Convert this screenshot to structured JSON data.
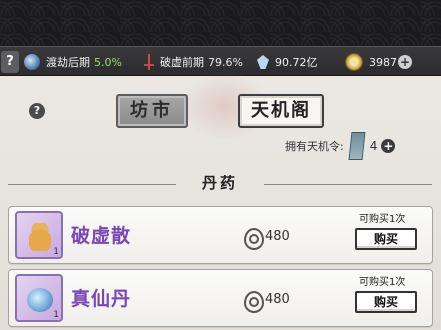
{
  "status_bar": {
    "help": "?",
    "realm": {
      "label": "渡劫后期",
      "percent": "5.0%"
    },
    "breakthrough": {
      "label": "破虚前期",
      "percent": "79.6%"
    },
    "spirit_stones": "90.72亿",
    "currency": "3987",
    "add": "+"
  },
  "tabs": [
    {
      "label": "坊市",
      "selected": true
    },
    {
      "label": "天机阁",
      "selected": false
    }
  ],
  "help_label": "?",
  "tokens": {
    "label": "拥有天机令:",
    "count": "4",
    "add": "+"
  },
  "section_title": "丹药",
  "items": [
    {
      "name": "破虚散",
      "price": "480",
      "limit": "可购买1次",
      "buy": "购买",
      "count": "1",
      "icon": "gourd-pill-icon"
    },
    {
      "name": "真仙丹",
      "price": "480",
      "limit": "可购买1次",
      "buy": "购买",
      "count": "1",
      "icon": "immortal-pill-icon"
    }
  ],
  "colors": {
    "item_name": "#7a45b6",
    "realm_percent": "#9adf6a",
    "status_bg": "#2b2b2e"
  }
}
